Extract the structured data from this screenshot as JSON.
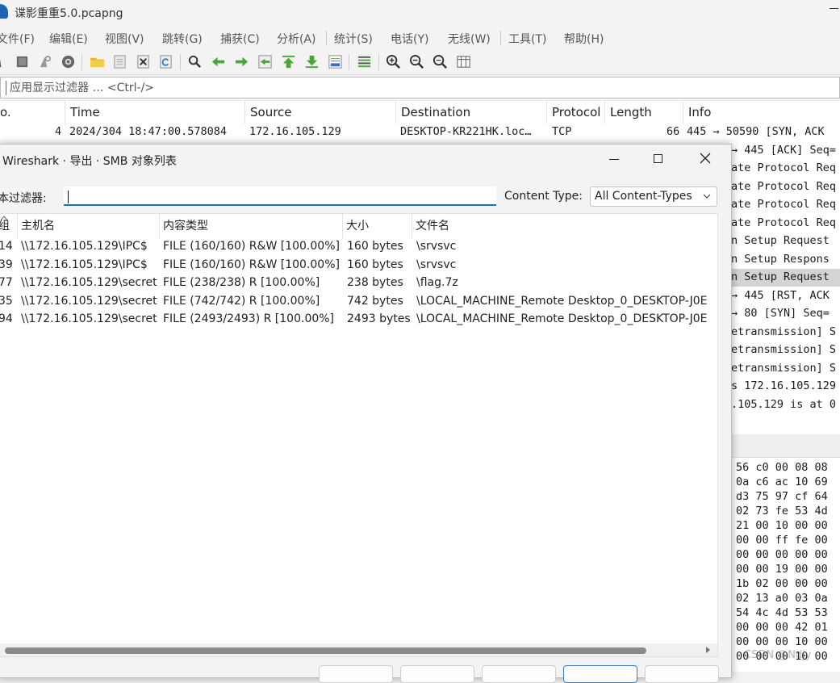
{
  "window": {
    "title": "谍影重重5.0.pcapng"
  },
  "menu": [
    {
      "label": "文件(F)"
    },
    {
      "label": "编辑(E)"
    },
    {
      "label": "视图(V)"
    },
    {
      "label": "跳转(G)"
    },
    {
      "label": "捕获(C)"
    },
    {
      "label": "分析(A)"
    },
    {
      "label": "统计(S)"
    },
    {
      "label": "电话(Y)"
    },
    {
      "label": "无线(W)"
    },
    {
      "label": "工具(T)"
    },
    {
      "label": "帮助(H)"
    }
  ],
  "display_filter": {
    "placeholder": "应用显示过滤器 … <Ctrl-/>"
  },
  "packet_list": {
    "columns": {
      "no": "o.",
      "time": "Time",
      "source": "Source",
      "destination": "Destination",
      "protocol": "Protocol",
      "length": "Length",
      "info": "Info"
    },
    "first_row": {
      "no": "4",
      "time": "2024/304 18:47:00.578084",
      "source": "172.16.105.129",
      "destination": "DESKTOP-KR221HK.loc…",
      "protocol": "TCP",
      "length": "66",
      "info": "445 → 50590 [SYN, ACK"
    },
    "info_rows": [
      "→ 445 [ACK] Seq=",
      "ate Protocol Req",
      "ate Protocol Req",
      "ate Protocol Req",
      "ate Protocol Req",
      "n Setup Request",
      "n Setup Respons",
      "n Setup Request",
      "→ 445 [RST, ACK",
      "→ 80 [SYN] Seq=",
      "etransmission] S",
      "etransmission] S",
      "etransmission] S",
      "s 172.16.105.129",
      ".105.129 is at 0"
    ]
  },
  "hex_pane": {
    "lines": [
      "56 c0 00 08 08",
      "0a c6 ac 10 69",
      "d3 75 97 cf 64",
      "02 73 fe 53 4d",
      "21 00 10 00 00",
      "00 00 ff fe 00",
      "00 00 00 00 00",
      "00 00 19 00 00",
      "1b 02 00 00 00",
      "02 13 a0 03 0a",
      "54 4c 4d 53 53",
      "00 00 00 42 01",
      "00 00 00 10 00",
      "00 00 00 10 00"
    ]
  },
  "dialog": {
    "title": "Wireshark · 导出 · SMB 对象列表",
    "text_filter_label": "本过滤器:",
    "text_filter_value": "",
    "content_type_label": "Content Type:",
    "content_type_value": "All Content-Types",
    "table": {
      "columns": {
        "group": "组",
        "hostname": "主机名",
        "content_type": "内容类型",
        "size": "大小",
        "filename": "文件名"
      },
      "rows": [
        {
          "group": "14",
          "hostname": "\\\\172.16.105.129\\IPC$",
          "content_type": "FILE (160/160) R&W [100.00%]",
          "size": "160 bytes",
          "filename": "\\srvsvc"
        },
        {
          "group": "39",
          "hostname": "\\\\172.16.105.129\\IPC$",
          "content_type": "FILE (160/160) R&W [100.00%]",
          "size": "160 bytes",
          "filename": "\\srvsvc"
        },
        {
          "group": "77",
          "hostname": "\\\\172.16.105.129\\secret",
          "content_type": "FILE (238/238) R [100.00%]",
          "size": "238 bytes",
          "filename": "\\flag.7z"
        },
        {
          "group": "35",
          "hostname": "\\\\172.16.105.129\\secret",
          "content_type": "FILE (742/742) R [100.00%]",
          "size": "742 bytes",
          "filename": "\\LOCAL_MACHINE_Remote Desktop_0_DESKTOP-J0E"
        },
        {
          "group": "94",
          "hostname": "\\\\172.16.105.129\\secret",
          "content_type": "FILE (2493/2493) R [100.00%]",
          "size": "2493 bytes",
          "filename": "\\LOCAL_MACHINE_Remote Desktop_0_DESKTOP-J0E"
        }
      ]
    }
  },
  "watermark": "CSDN @Ndjy",
  "icons": {
    "toolbar": [
      "shark-fin-start-icon",
      "stop-capture-icon",
      "restart-capture-icon",
      "capture-options-icon",
      "open-file-icon",
      "save-file-icon",
      "close-file-icon",
      "reload-icon",
      "find-packet-icon",
      "go-back-icon",
      "go-forward-icon",
      "go-to-packet-icon",
      "go-first-icon",
      "go-last-icon",
      "autoscroll-icon",
      "colorize-icon",
      "zoom-in-icon",
      "zoom-out-icon",
      "zoom-normal-icon",
      "resize-columns-icon"
    ]
  },
  "colors": {
    "accent": "#1d6fb8",
    "selection": "#d4d4d4"
  }
}
